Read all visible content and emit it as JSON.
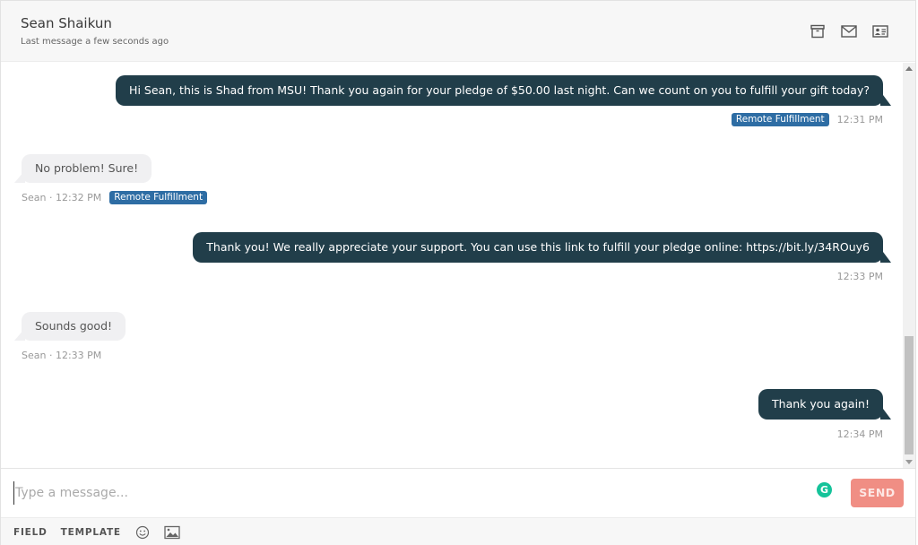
{
  "header": {
    "contact_name": "Sean Shaikun",
    "subtitle": "Last message a few seconds ago",
    "icons": [
      "archive-icon",
      "envelope-icon",
      "contact-card-icon"
    ]
  },
  "messages": [
    {
      "direction": "outgoing",
      "text": "Hi Sean, this is Shad from MSU! Thank you again for your pledge of $50.00 last night. Can we count on you to fulfill your gift today?",
      "badge": "Remote Fulfillment",
      "time": "12:31 PM"
    },
    {
      "direction": "incoming",
      "text": "No problem! Sure!",
      "sender_meta": "Sean · 12:32 PM",
      "badge": "Remote Fulfillment"
    },
    {
      "direction": "outgoing",
      "text": "Thank you! We really appreciate your support. You can use this link to fulfill your pledge online: https://bit.ly/34ROuy6",
      "time": "12:33 PM"
    },
    {
      "direction": "incoming",
      "text": "Sounds good!",
      "sender_meta": "Sean · 12:33 PM"
    },
    {
      "direction": "outgoing",
      "text": "Thank you again!",
      "time": "12:34 PM"
    }
  ],
  "composer": {
    "placeholder": "Type a message...",
    "value": "",
    "grammarly_glyph": "G",
    "send_label": "SEND"
  },
  "toolbar": {
    "field_label": "FIELD",
    "template_label": "TEMPLATE",
    "icons": [
      "emoji-icon",
      "image-icon"
    ]
  },
  "colors": {
    "outgoing_bubble": "#213e4a",
    "incoming_bubble": "#f0f0f2",
    "badge": "#2e6da4",
    "send_button": "#f08e84",
    "grammarly": "#15c39a"
  }
}
